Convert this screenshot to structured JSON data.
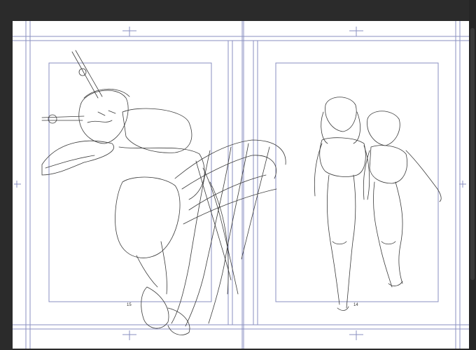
{
  "app": {
    "canvas_background": "#2b2b2b",
    "paper_color": "#ffffff",
    "guide_color": "#8a8fc0",
    "sketch_color": "#3a3a3a"
  },
  "spread": {
    "left_page_number": "15",
    "right_page_number": "14"
  }
}
